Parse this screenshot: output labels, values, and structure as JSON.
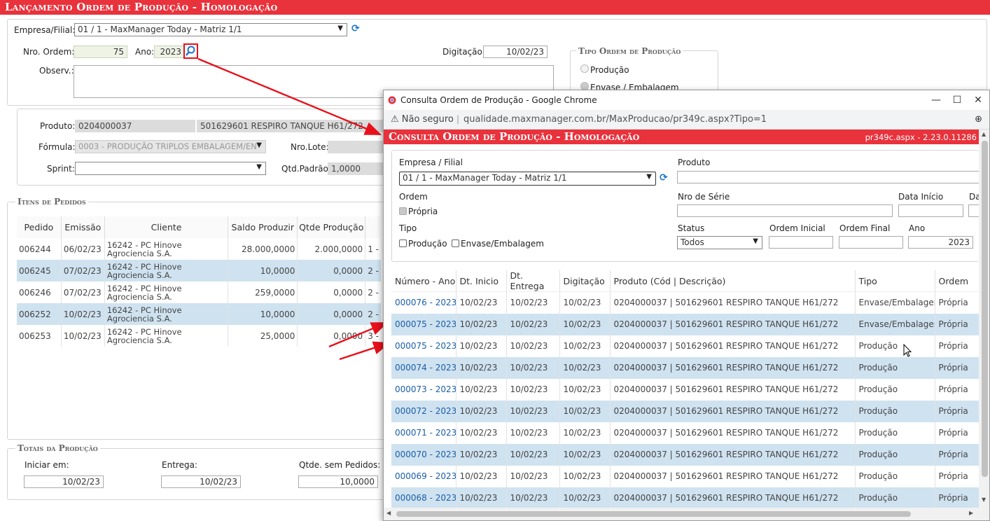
{
  "main": {
    "title": "Lançamento Ordem de Produção  - Homologação",
    "empresa_label": "Empresa/Filial:",
    "empresa_value": "01 / 1 - MaxManager Today - Matriz 1/1",
    "nro_ordem_label": "Nro. Ordem:",
    "nro_ordem_value": "75",
    "ano_label": "Ano:",
    "ano_value": "2023",
    "digitacao_label": "Digitação:",
    "digitacao_value": "10/02/23",
    "observ_label": "Observ.:",
    "tipo_section": "Tipo Ordem de Produção",
    "tipo_opt1": "Produção",
    "tipo_opt2": "Envase / Embalagem",
    "produto_label": "Produto:",
    "produto_code": "0204000037",
    "produto_desc": "501629601 RESPIRO TANQUE H61/272",
    "formula_label": "Fórmula:",
    "formula_value": "0003 - PRODUÇÃO TRIPLOS EMBALAGEM/EN",
    "nro_lote_label": "Nro.Lote:",
    "sprint_label": "Sprint:",
    "qtd_padrao_label": "Qtd.Padrão:",
    "qtd_padrao_value": "1,0000",
    "itens_section": "Itens de Pedidos",
    "itens_headers": [
      "Pedido",
      "Emissão",
      "Cliente",
      "Saldo Produzir",
      "Qtde Produção"
    ],
    "itens_rows": [
      {
        "pedido": "006244",
        "emissao": "06/02/23",
        "cliente": "16242 - PC Hinove Agrociencia S.A.",
        "saldo": "28.000,0000",
        "qtde": "2.000,0000",
        "extra": "1 -"
      },
      {
        "pedido": "006245",
        "emissao": "07/02/23",
        "cliente": "16242 - PC Hinove Agrociencia S.A.",
        "saldo": "10,0000",
        "qtde": "0,0000",
        "extra": "2 -"
      },
      {
        "pedido": "006246",
        "emissao": "07/02/23",
        "cliente": "16242 - PC Hinove Agrociencia S.A.",
        "saldo": "259,0000",
        "qtde": "0,0000",
        "extra": "2 -"
      },
      {
        "pedido": "006252",
        "emissao": "10/02/23",
        "cliente": "16242 - PC Hinove Agrociencia S.A.",
        "saldo": "10,0000",
        "qtde": "0,0000",
        "extra": "2 -"
      },
      {
        "pedido": "006253",
        "emissao": "10/02/23",
        "cliente": "16242 - PC Hinove Agrociencia S.A.",
        "saldo": "25,0000",
        "qtde": "0,0000",
        "extra": "3 -"
      }
    ],
    "totais_section": "Totais da Produção",
    "iniciar_label": "Iniciar em:",
    "iniciar_value": "10/02/23",
    "entrega_label": "Entrega:",
    "entrega_value": "10/02/23",
    "qtde_sem_label": "Qtde. sem Pedidos:",
    "qtde_sem_value": "10,0000"
  },
  "popup": {
    "window_title": "Consulta Ordem de Produção - Google Chrome",
    "not_secure": "Não seguro",
    "url": "qualidade.maxmanager.com.br/MaxProducao/pr349c.aspx?Tipo=1",
    "title": "Consulta Ordem de Produção  - Homologação",
    "version": "pr349c.aspx - 2.23.0.11286",
    "empresa_label": "Empresa / Filial",
    "empresa_value": "01 / 1 - MaxManager Today - Matriz 1/1",
    "produto_label": "Produto",
    "ordem_label": "Ordem",
    "propria_label": "Própria",
    "nro_serie_label": "Nro de Série",
    "data_inicio_label": "Data Início",
    "data_fim_label": "Da",
    "tipo_label": "Tipo",
    "tipo_producao": "Produção",
    "tipo_envase": "Envase/Embalagem",
    "status_label": "Status",
    "status_value": "Todos",
    "ordem_inicial_label": "Ordem Inicial",
    "ordem_final_label": "Ordem Final",
    "ano_label": "Ano",
    "ano_value": "2023",
    "headers": [
      "Número - Ano",
      "Dt. Inicio",
      "Dt. Entrega",
      "Digitação",
      "Produto (Cód | Descrição)",
      "Tipo",
      "Ordem"
    ],
    "rows": [
      {
        "num": "000076 - 2023",
        "ini": "10/02/23",
        "ent": "10/02/23",
        "dig": "10/02/23",
        "prod": "0204000037 | 501629601 RESPIRO TANQUE H61/272",
        "tipo": "Envase/Embalagem",
        "ordem": "Própria"
      },
      {
        "num": "000075 - 2023",
        "ini": "10/02/23",
        "ent": "10/02/23",
        "dig": "10/02/23",
        "prod": "0204000037 | 501629601 RESPIRO TANQUE H61/272",
        "tipo": "Envase/Embalagem",
        "ordem": "Própria"
      },
      {
        "num": "000075 - 2023",
        "ini": "10/02/23",
        "ent": "10/02/23",
        "dig": "10/02/23",
        "prod": "0204000037 | 501629601 RESPIRO TANQUE H61/272",
        "tipo": "Produção",
        "ordem": "Própria"
      },
      {
        "num": "000074 - 2023",
        "ini": "10/02/23",
        "ent": "10/02/23",
        "dig": "10/02/23",
        "prod": "0204000037 | 501629601 RESPIRO TANQUE H61/272",
        "tipo": "Produção",
        "ordem": "Própria"
      },
      {
        "num": "000073 - 2023",
        "ini": "10/02/23",
        "ent": "10/02/23",
        "dig": "10/02/23",
        "prod": "0204000037 | 501629601 RESPIRO TANQUE H61/272",
        "tipo": "Produção",
        "ordem": "Própria"
      },
      {
        "num": "000072 - 2023",
        "ini": "10/02/23",
        "ent": "10/02/23",
        "dig": "10/02/23",
        "prod": "0204000037 | 501629601 RESPIRO TANQUE H61/272",
        "tipo": "Produção",
        "ordem": "Própria"
      },
      {
        "num": "000071 - 2023",
        "ini": "10/02/23",
        "ent": "10/02/23",
        "dig": "10/02/23",
        "prod": "0204000037 | 501629601 RESPIRO TANQUE H61/272",
        "tipo": "Produção",
        "ordem": "Própria"
      },
      {
        "num": "000070 - 2023",
        "ini": "10/02/23",
        "ent": "10/02/23",
        "dig": "10/02/23",
        "prod": "0204000037 | 501629601 RESPIRO TANQUE H61/272",
        "tipo": "Produção",
        "ordem": "Própria"
      },
      {
        "num": "000069 - 2023",
        "ini": "10/02/23",
        "ent": "10/02/23",
        "dig": "10/02/23",
        "prod": "0204000037 | 501629601 RESPIRO TANQUE H61/272",
        "tipo": "Produção",
        "ordem": "Própria"
      },
      {
        "num": "000068 - 2023",
        "ini": "10/02/23",
        "ent": "10/02/23",
        "dig": "10/02/23",
        "prod": "0204000037 | 501629601 RESPIRO TANQUE H61/272",
        "tipo": "Produção",
        "ordem": "Própria"
      }
    ]
  },
  "colors": {
    "accent": "#e8323c",
    "row_highlight": "#cfe2f0",
    "link": "#1a5ea8"
  }
}
